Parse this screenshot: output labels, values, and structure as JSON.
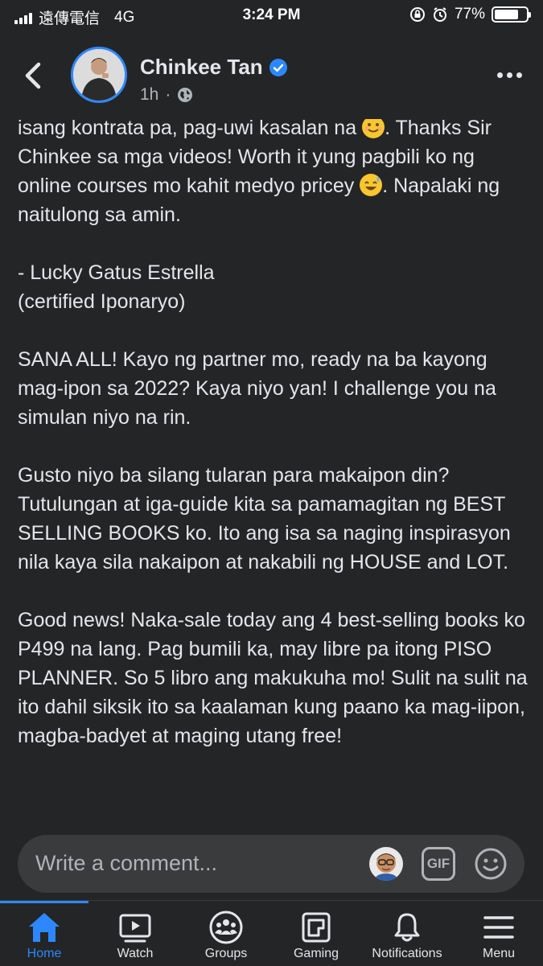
{
  "status_bar": {
    "carrier": "遠傳電信",
    "network": "4G",
    "time": "3:24 PM",
    "battery": "77%",
    "battery_level": 0.77
  },
  "header": {
    "author": "Chinkee Tan",
    "timestamp": "1h",
    "separator": "·",
    "privacy_icon": "globe-icon"
  },
  "post": {
    "paragraphs": [
      {
        "parts": [
          "isang kontrata pa, pag-uwi kasalan na ",
          ". Thanks Sir Chinkee sa mga videos! Worth it yung pagbili ko ng online courses mo kahit medyo pricey ",
          ". Napalaki ng naitulong sa amin."
        ]
      },
      {
        "text": "- Lucky Gatus Estrella\n   (certified Iponaryo)"
      },
      {
        "text": "SANA ALL! Kayo ng partner mo, ready na ba kayong mag-ipon sa 2022? Kaya niyo yan! I challenge you na simulan niyo na rin."
      },
      {
        "text": "Gusto niyo ba silang tularan para makaipon din? Tutulungan at iga-guide kita sa pamamagitan ng BEST SELLING BOOKS ko. Ito ang isa sa naging inspirasyon nila kaya sila nakaipon at nakabili ng HOUSE and LOT."
      },
      {
        "text": "Good news! Naka-sale today ang 4 best-selling books ko P499 na lang. Pag bumili ka, may libre pa itong PISO PLANNER. So 5 libro ang makukuha mo! Sulit na sulit na ito dahil siksik ito sa kaalaman kung paano ka mag-iipon, magba-badyet at maging utang free!"
      }
    ]
  },
  "comment": {
    "placeholder": "Write a comment...",
    "gif_label": "GIF"
  },
  "nav": {
    "items": [
      {
        "label": "Home",
        "icon": "home-icon",
        "active": true
      },
      {
        "label": "Watch",
        "icon": "video-icon"
      },
      {
        "label": "Groups",
        "icon": "groups-icon"
      },
      {
        "label": "Gaming",
        "icon": "gaming-icon"
      },
      {
        "label": "Notifications",
        "icon": "bell-icon"
      },
      {
        "label": "Menu",
        "icon": "hamburger-icon"
      }
    ]
  },
  "colors": {
    "background": "#242526",
    "accent": "#2d88ff",
    "text": "#e4e6eb",
    "muted": "#b0b3b8",
    "input": "#3a3b3c"
  }
}
